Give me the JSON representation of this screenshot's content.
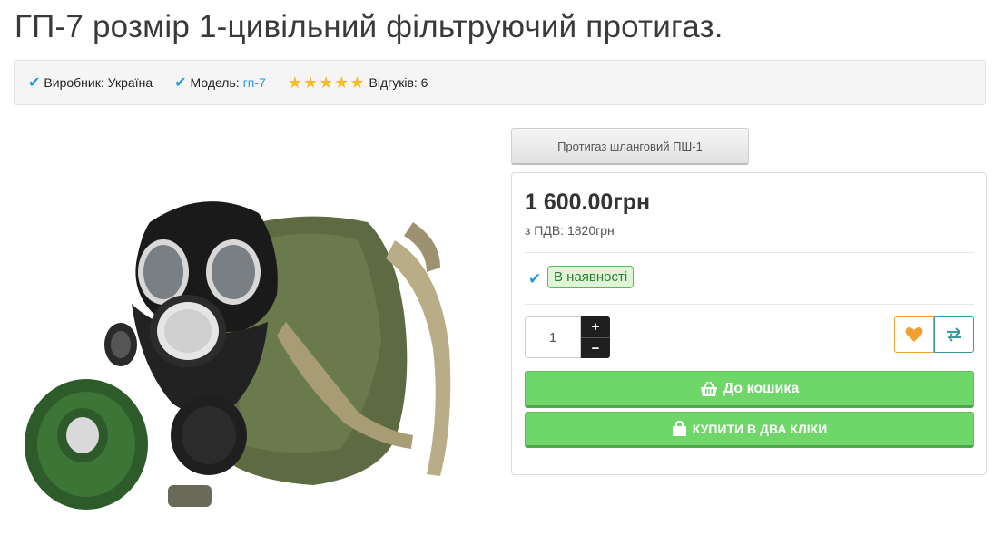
{
  "page": {
    "title": "ГП-7 розмір 1-цивільний фільтруючий протигаз."
  },
  "meta": {
    "manufacturer_label": "Виробник:",
    "manufacturer_value": "Україна",
    "model_label": "Модель:",
    "model_value": "гп-7",
    "rating_stars": 5,
    "reviews_label": "Відгуків: 6"
  },
  "related": {
    "tab_label": "Протигаз шланговий ПШ-1"
  },
  "purchase": {
    "price": "1 600.00грн",
    "vat_price": "з ПДВ: 1820грн",
    "stock_status": "В наявності",
    "quantity": "1",
    "plus_label": "+",
    "minus_label": "−",
    "add_to_cart_label": "До кошика",
    "buy_one_click_label": "КУПИТИ В ДВА КЛІКИ"
  },
  "icons": {
    "check": "check-icon",
    "star": "star-icon",
    "heart": "heart-icon",
    "compare": "compare-icon",
    "basket": "basket-icon",
    "bag": "shopping-bag-icon"
  },
  "colors": {
    "accent_blue": "#1e9be0",
    "star_yellow": "#f5bd1f",
    "button_green": "#6fd66a",
    "wishlist_orange": "#f0a030",
    "compare_teal": "#3c9a9a",
    "stock_green": "#2e7d32"
  }
}
